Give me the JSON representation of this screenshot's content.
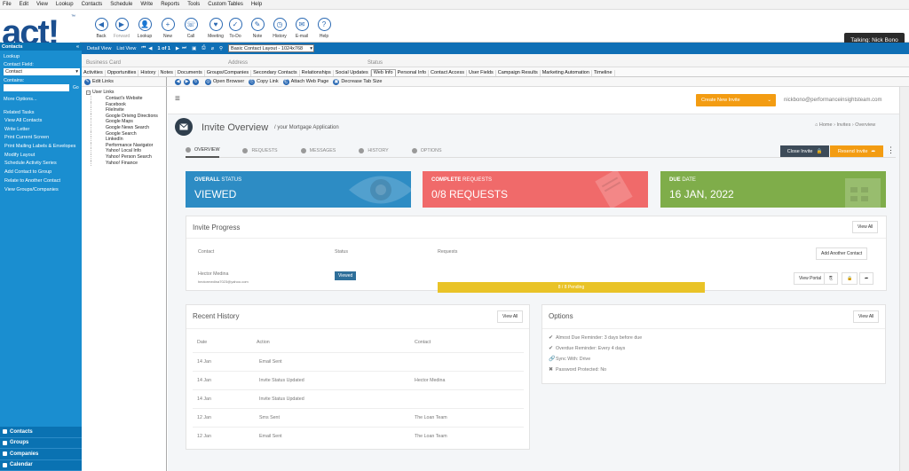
{
  "menu": [
    "File",
    "Edit",
    "View",
    "Lookup",
    "Contacts",
    "Schedule",
    "Write",
    "Reports",
    "Tools",
    "Custom Tables",
    "Help"
  ],
  "logo": "act!",
  "toolbar": [
    {
      "label": "Back",
      "icon": "back-icon",
      "glyph": "◀",
      "enabled": true
    },
    {
      "label": "Forward",
      "icon": "forward-icon",
      "glyph": "▶",
      "enabled": false
    },
    {
      "label": "Lookup",
      "icon": "lookup-icon",
      "glyph": "👤",
      "enabled": true
    },
    {
      "label": "New",
      "icon": "new-icon",
      "glyph": "+",
      "enabled": true
    },
    {
      "label": "Call",
      "icon": "phone-icon",
      "glyph": "☏",
      "enabled": true
    },
    {
      "label": "Meeting",
      "icon": "meeting-icon",
      "glyph": "♥",
      "enabled": true
    },
    {
      "label": "To-Do",
      "icon": "todo-icon",
      "glyph": "✓",
      "enabled": true
    },
    {
      "label": "Note",
      "icon": "note-icon",
      "glyph": "✎",
      "enabled": true
    },
    {
      "label": "History",
      "icon": "history-icon",
      "glyph": "◷",
      "enabled": true
    },
    {
      "label": "E-mail",
      "icon": "email-icon",
      "glyph": "✉",
      "enabled": true
    },
    {
      "label": "Help",
      "icon": "help-icon",
      "glyph": "?",
      "enabled": true
    }
  ],
  "talking": "Talking: Nick Bono",
  "viewbar": {
    "detail": "Detail View",
    "list": "List View",
    "record": "1 of 1",
    "layout": "Basic Contact Layout - 1024x768"
  },
  "record_labels": {
    "business_card": "Business Card",
    "address": "Address",
    "status": "Status"
  },
  "tabs": [
    "Activities",
    "Opportunities",
    "History",
    "Notes",
    "Documents",
    "Groups/Companies",
    "Secondary Contacts",
    "Relationships",
    "Social Updates",
    "Web Info",
    "Personal Info",
    "Contact Access",
    "User Fields",
    "Campaign Results",
    "Marketing Automation",
    "Timeline"
  ],
  "active_tab": "Web Info",
  "webtool": {
    "edit_links": "Edit Links",
    "open_browser": "Open Browser",
    "copy_link": "Copy Link",
    "attach": "Attach Web Page",
    "decrease": "Decrease Tab Size"
  },
  "tree": {
    "root": "User Links",
    "items": [
      "Contact's Website",
      "Facebook",
      "FileInvite",
      "Google Driving Directions",
      "Google Maps",
      "Google News Search",
      "Google Search",
      "LinkedIn",
      "Performance Navigator",
      "Yahoo! Local Info",
      "Yahoo! Person Search",
      "Yahoo! Finance"
    ]
  },
  "sidebar": {
    "header": "Contacts",
    "lookup": "Lookup",
    "contact_field_label": "Contact Field:",
    "contact_field_value": "Contact",
    "contains_label": "Contains:",
    "go": "Go",
    "more_options": "More Options...",
    "related_tasks": "Related Tasks",
    "tasks": [
      "View All Contacts",
      "Write Letter",
      "Print Current Screen",
      "Print Mailing Labels & Envelopes",
      "Modify Layout",
      "Schedule Activity Series",
      "Add Contact to Group",
      "Relate to Another Contact",
      "View Groups/Companies"
    ]
  },
  "bottom_nav": [
    "Contacts",
    "Groups",
    "Companies",
    "Calendar"
  ],
  "invite": {
    "create_btn": "Create New Invite",
    "email": "nickbono@performanceinsightsteam.com",
    "title": "Invite Overview",
    "subtitle": "/ your Mortgage Application",
    "breadcrumb": [
      "Home",
      "Invites",
      "Overview"
    ],
    "tabs": [
      "OVERVIEW",
      "REQUESTS",
      "MESSAGES",
      "HISTORY",
      "OPTIONS"
    ],
    "close_btn": "Close Invite",
    "resend_btn": "Resend Invite",
    "cards": [
      {
        "label_bold": "OVERALL",
        "label_rest": " STATUS",
        "value": "VIEWED",
        "color": "#2d8cc4"
      },
      {
        "label_bold": "COMPLETE",
        "label_rest": " REQUESTS",
        "value": "0/8 REQUESTS",
        "color": "#f06a6a"
      },
      {
        "label_bold": "DUE",
        "label_rest": " DATE",
        "value": "16 JAN, 2022",
        "color": "#7fad4a"
      }
    ],
    "progress": {
      "title": "Invite Progress",
      "view_all": "View All",
      "cols": [
        "Contact",
        "Status",
        "Requests"
      ],
      "add_contact": "Add Another Contact",
      "name": "Hector Medina",
      "contact_email": "hectormedina7023@yahoo.com",
      "status": "Viewed",
      "bar_text": "8 / 8 Pending",
      "view_portal": "View Portal"
    },
    "history": {
      "title": "Recent History",
      "view_all": "View All",
      "cols": [
        "Date",
        "Action",
        "Contact"
      ],
      "rows": [
        [
          "14 Jan",
          "Email Sent",
          ""
        ],
        [
          "14 Jan",
          "Invite Status Updated",
          "Hector Medina"
        ],
        [
          "14 Jan",
          "Invite Status Updated",
          ""
        ],
        [
          "12 Jan",
          "Sms Sent",
          "The Loan Team"
        ],
        [
          "12 Jan",
          "Email Sent",
          "The Loan Team"
        ]
      ]
    },
    "options": {
      "title": "Options",
      "view_all": "View All",
      "items": [
        {
          "icon": "check-icon",
          "glyph": "✔",
          "text": "Almost Due Reminder: 3 days before due"
        },
        {
          "icon": "check-icon",
          "glyph": "✔",
          "text": "Overdue Reminder: Every 4 days"
        },
        {
          "icon": "link-icon",
          "glyph": "🔗",
          "text": "Sync With: Drive"
        },
        {
          "icon": "cross-icon",
          "glyph": "✖",
          "text": "Password Protected: No"
        }
      ]
    }
  }
}
